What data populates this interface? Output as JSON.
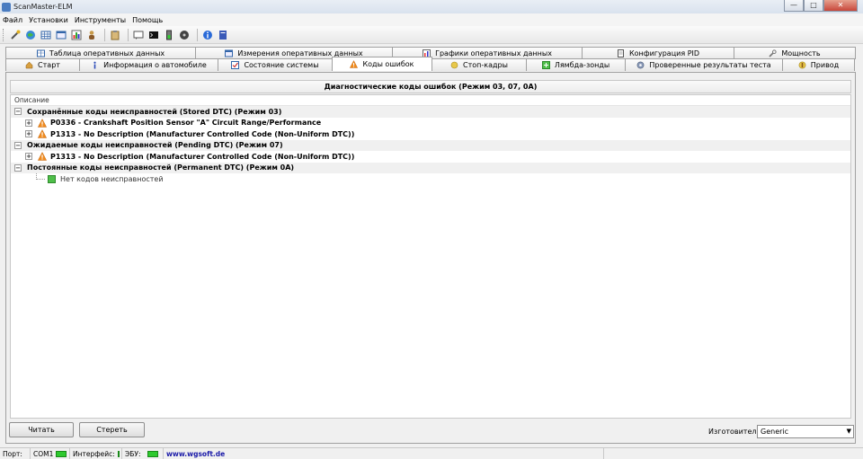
{
  "window": {
    "title": "ScanMaster-ELM",
    "minimize": "—",
    "maximize": "□",
    "close": "✕"
  },
  "menu": [
    "Файл",
    "Установки",
    "Инструменты",
    "Помощь"
  ],
  "tabs_row1": [
    {
      "label": "Таблица оперативных данных",
      "icon": "grid-icon"
    },
    {
      "label": "Измерения оперативных данных",
      "icon": "table-icon"
    },
    {
      "label": "Графики оперативных данных",
      "icon": "chart-icon"
    },
    {
      "label": "Конфигурация PID",
      "icon": "document-icon"
    },
    {
      "label": "Мощность",
      "icon": "tool-icon"
    }
  ],
  "tabs_row2": [
    {
      "label": "Старт",
      "icon": "home-icon"
    },
    {
      "label": "Информация о автомобиле",
      "icon": "info-icon"
    },
    {
      "label": "Состояние системы",
      "icon": "check-icon"
    },
    {
      "label": "Коды ошибок",
      "icon": "warning-icon",
      "active": true
    },
    {
      "label": "Стоп-кадры",
      "icon": "snapshot-icon"
    },
    {
      "label": "Лямбда-зонды",
      "icon": "sensor-icon"
    },
    {
      "label": "Проверенные результаты теста",
      "icon": "gear-icon"
    },
    {
      "label": "Привод",
      "icon": "drive-icon"
    }
  ],
  "panel": {
    "header": "Диагностические коды ошибок (Режим 03, 07, 0A)",
    "column": "Описание",
    "groups": [
      {
        "label": "Сохранённые коды неисправностей (Stored DTC) (Режим 03)",
        "items": [
          "P0336 - Crankshaft Position Sensor \"A\" Circuit Range/Performance",
          "P1313 - No Description (Manufacturer Controlled Code (Non-Uniform DTC))"
        ]
      },
      {
        "label": "Ожидаемые коды неисправностей (Pending DTC) (Режим 07)",
        "items": [
          "P1313 - No Description (Manufacturer Controlled Code (Non-Uniform DTC))"
        ]
      },
      {
        "label": "Постоянные коды неисправностей (Permanent DTC) (Режим 0A)",
        "leaf": "Нет кодов неисправностей"
      }
    ]
  },
  "buttons": {
    "read": "Читать",
    "clear": "Стереть"
  },
  "manufacturer": {
    "label": "Изготовитель",
    "value": "Generic"
  },
  "status": {
    "port_label": "Порт:",
    "port_value": "COM1",
    "interface_label": "Интерфейс:",
    "ecu_label": "ЭБУ:",
    "url": "www.wgsoft.de"
  },
  "colors": {
    "warning": "#f08a1c",
    "led": "#2ec92e",
    "link": "#1a1aa8"
  }
}
